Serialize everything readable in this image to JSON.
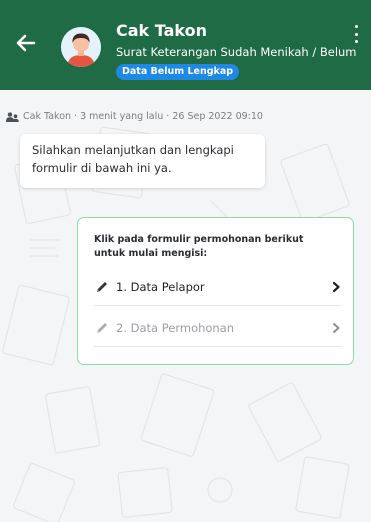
{
  "header": {
    "contact_name": "Cak Takon",
    "subtitle": "Surat Keterangan Sudah Menikah / Belum",
    "status_badge": "Data Belum Lengkap",
    "back_icon": "arrow-left-icon",
    "menu_icon": "kebab-vertical-icon",
    "color": "#1f6b45",
    "badge_color": "#1e88e5"
  },
  "message": {
    "meta": "Cak Takon · 3 menit yang lalu · 26 Sep 2022 09:10",
    "meta_icon": "user-group-icon",
    "text": "Silahkan melanjutkan dan lengkapi formulir di bawah ini ya."
  },
  "form_card": {
    "title": "Klik pada formulir permohonan berikut untuk mulai mengisi:",
    "border_color": "#8fdaa8",
    "items": [
      {
        "label": "1. Data Pelapor",
        "icon": "pencil-icon",
        "enabled": true
      },
      {
        "label": "2. Data Permohonan",
        "icon": "pencil-icon",
        "enabled": false
      }
    ]
  }
}
